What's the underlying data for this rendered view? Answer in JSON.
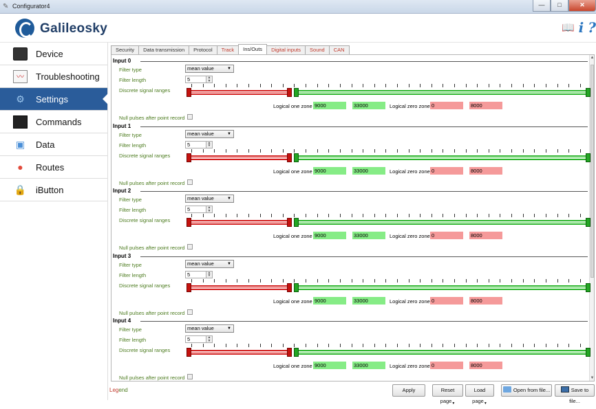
{
  "window": {
    "title": "Configurator4",
    "minimize": "—",
    "maximize": "□",
    "close": "✕"
  },
  "header": {
    "brand": "Galileosky",
    "help_icon": "i",
    "question_icon": "?",
    "book_icon": "📖"
  },
  "sidebar": {
    "items": [
      {
        "label": "Device",
        "icon": "device-icon",
        "active": false
      },
      {
        "label": "Troubleshooting",
        "icon": "chart-icon",
        "active": false
      },
      {
        "label": "Settings",
        "icon": "gear-icon",
        "active": true
      },
      {
        "label": "Commands",
        "icon": "terminal-icon",
        "active": false
      },
      {
        "label": "Data",
        "icon": "data-icon",
        "active": false
      },
      {
        "label": "Routes",
        "icon": "map-pin-icon",
        "active": false
      },
      {
        "label": "iButton",
        "icon": "lock-icon",
        "active": false
      }
    ]
  },
  "tabs": [
    {
      "label": "Security",
      "red": false
    },
    {
      "label": "Data transmission",
      "red": false
    },
    {
      "label": "Protocol",
      "red": false
    },
    {
      "label": "Track",
      "red": true
    },
    {
      "label": "Ins/Outs",
      "red": false,
      "active": true
    },
    {
      "label": "Digital inputs",
      "red": true
    },
    {
      "label": "Sound",
      "red": true
    },
    {
      "label": "CAN",
      "red": true
    }
  ],
  "labels": {
    "filter_type": "Filter type",
    "filter_length": "Filter length",
    "discrete_ranges": "Discrete signal ranges",
    "null_pulses": "Null pulses after point record",
    "logical_one": "Logical one zone",
    "logical_zero": "Logical zero zone"
  },
  "inputs": [
    {
      "title": "Input 0",
      "filter_type": "mean value",
      "filter_length": "5",
      "one_min": "9000",
      "one_max": "33000",
      "zero_min": "0",
      "zero_max": "8000"
    },
    {
      "title": "Input 1",
      "filter_type": "mean value",
      "filter_length": "5",
      "one_min": "9000",
      "one_max": "33000",
      "zero_min": "0",
      "zero_max": "8000"
    },
    {
      "title": "Input 2",
      "filter_type": "mean value",
      "filter_length": "5",
      "one_min": "9000",
      "one_max": "33000",
      "zero_min": "0",
      "zero_max": "8000"
    },
    {
      "title": "Input 3",
      "filter_type": "mean value",
      "filter_length": "5",
      "one_min": "9000",
      "one_max": "33000",
      "zero_min": "0",
      "zero_max": "8000"
    },
    {
      "title": "Input 4",
      "filter_type": "mean value",
      "filter_length": "5",
      "one_min": "9000",
      "one_max": "33000",
      "zero_min": "0",
      "zero_max": "8000"
    }
  ],
  "bottom": {
    "legend_a": "Leg",
    "legend_b": "end",
    "apply": "Apply",
    "reset_page": "Reset page",
    "load_page": "Load page",
    "open_file": "Open from file...",
    "save_file": "Save to file..."
  },
  "colors": {
    "accent": "#2a5c9a",
    "one_zone": "#86ec86",
    "zero_zone": "#f59a9a",
    "label_green": "#4a7a1c",
    "tab_red": "#c0392b"
  }
}
